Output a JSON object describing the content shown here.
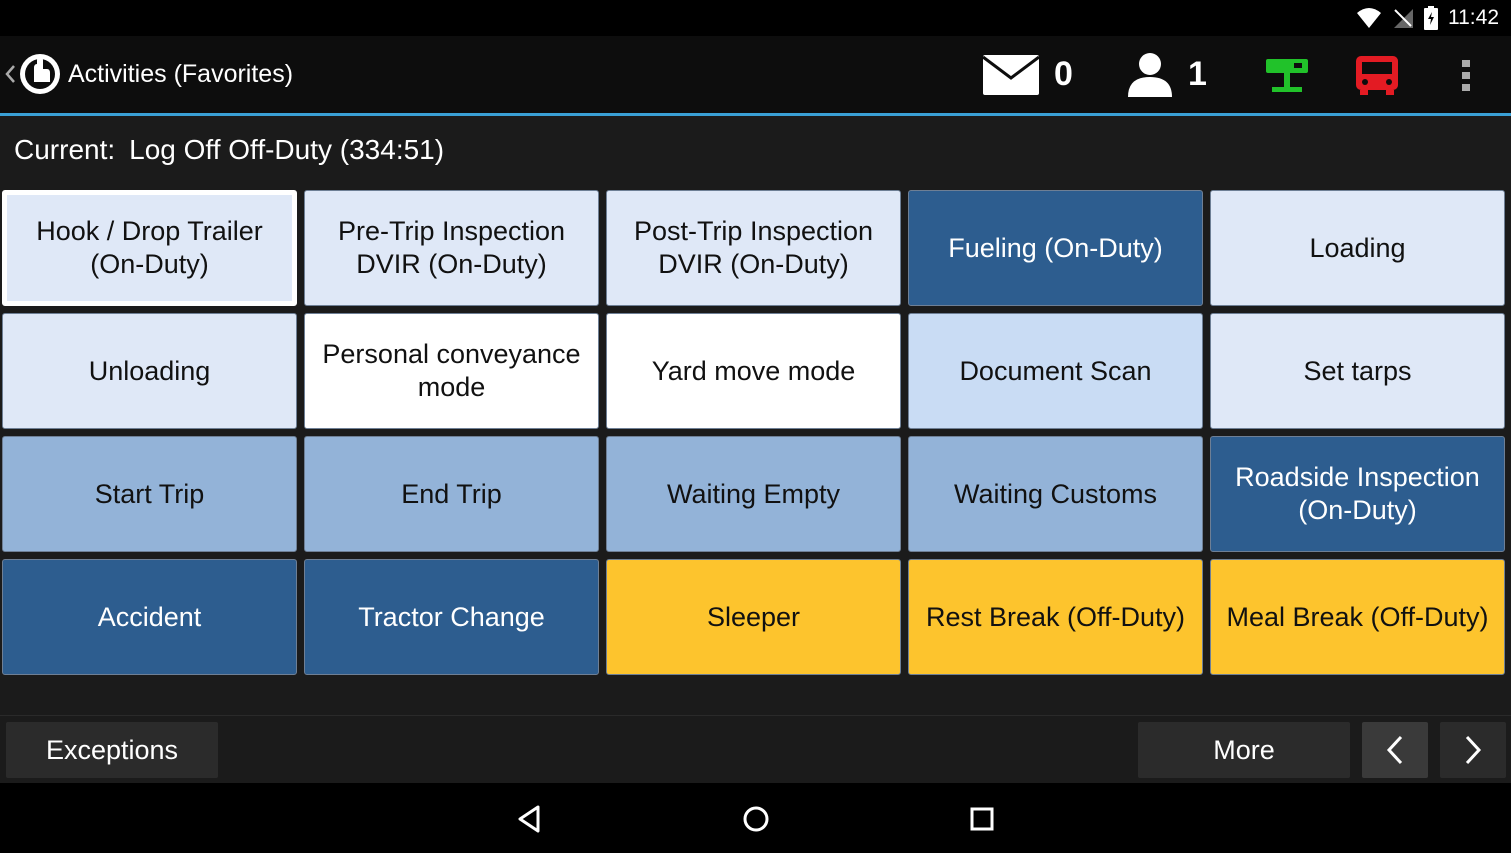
{
  "status_bar": {
    "time": "11:42"
  },
  "action_bar": {
    "title": "Activities (Favorites)",
    "messages_count": "0",
    "users_count": "1"
  },
  "current": {
    "label": "Current:",
    "value": "Log Off Off-Duty (334:51)"
  },
  "tiles": [
    [
      "Hook / Drop Trailer\n(On-Duty)",
      "Pre-Trip Inspection\nDVIR (On-Duty)",
      "Post-Trip Inspection\nDVIR (On-Duty)",
      "Fueling (On-Duty)",
      "Loading"
    ],
    [
      "Unloading",
      "Personal conveyance\nmode",
      "Yard move mode",
      "Document Scan",
      "Set tarps"
    ],
    [
      "Start Trip",
      "End Trip",
      "Waiting Empty",
      "Waiting Customs",
      "Roadside Inspection\n(On-Duty)"
    ],
    [
      "Accident",
      "Tractor Change",
      "Sleeper",
      "Rest Break (Off-Duty)",
      "Meal Break (Off-Duty)"
    ]
  ],
  "colors": {
    "accent_line": "#3aa0d6",
    "tile_dark": "#2d5d8f",
    "tile_yellow": "#fdc42d",
    "network_icon": "#21c22a",
    "vehicle_icon": "#e31b23"
  },
  "icons": [
    "wifi-icon",
    "signal-icon",
    "battery-icon",
    "mail-icon",
    "user-icon",
    "network-status-icon",
    "vehicle-icon",
    "overflow-menu-icon",
    "back-icon",
    "home-icon",
    "recents-icon"
  ],
  "bottom": {
    "exceptions_label": "Exceptions",
    "more_label": "More"
  }
}
